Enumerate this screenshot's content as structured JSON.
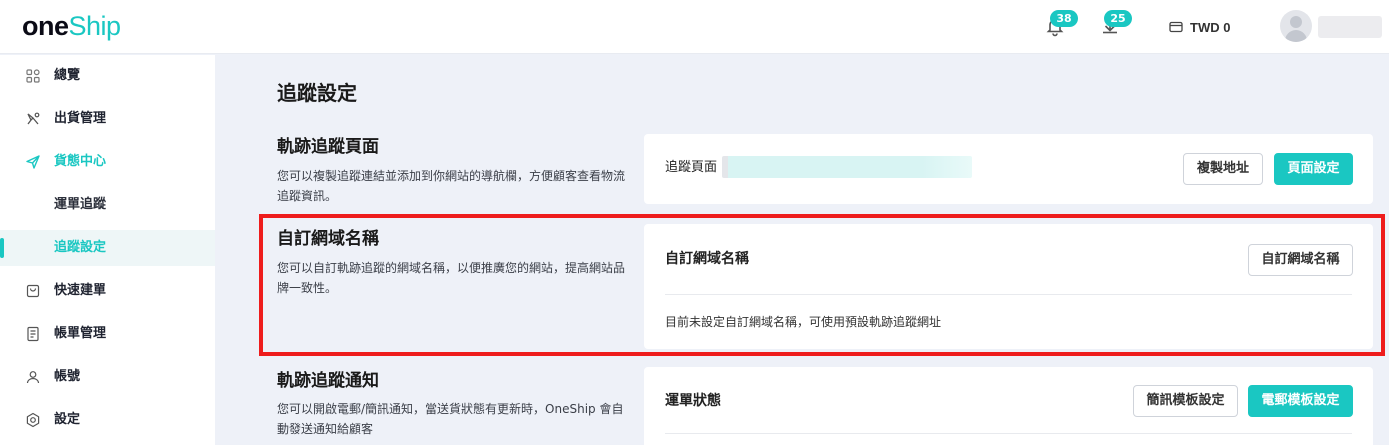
{
  "header": {
    "logo_part1": "one",
    "logo_part2": "Ship",
    "notification_count": "38",
    "download_count": "25",
    "balance": "TWD 0"
  },
  "sidebar": {
    "items": [
      {
        "label": "總覽",
        "icon": "grid-icon"
      },
      {
        "label": "出貨管理",
        "icon": "shipping-icon"
      },
      {
        "label": "貨態中心",
        "icon": "send-icon"
      },
      {
        "label": "運單追蹤",
        "icon": ""
      },
      {
        "label": "追蹤設定",
        "icon": ""
      },
      {
        "label": "快速建單",
        "icon": "bag-icon"
      },
      {
        "label": "帳單管理",
        "icon": "bill-icon"
      },
      {
        "label": "帳號",
        "icon": "user-icon"
      },
      {
        "label": "設定",
        "icon": "gear-icon"
      }
    ]
  },
  "main": {
    "title": "追蹤設定",
    "sections": {
      "tracking_page": {
        "title": "軌跡追蹤頁面",
        "desc": "您可以複製追蹤連結並添加到你網站的導航欄，方便顧客查看物流追蹤資訊。",
        "card_label": "追蹤頁面",
        "copy_button": "複製地址",
        "page_settings_button": "頁面設定"
      },
      "custom_domain": {
        "title": "自訂網域名稱",
        "desc": "您可以自訂軌跡追蹤的網域名稱，以便推廣您的網站，提高網站品牌一致性。",
        "card_label": "自訂網域名稱",
        "button": "自訂網域名稱",
        "note": "目前未設定自訂網域名稱，可使用預設軌跡追蹤網址"
      },
      "tracking_notice": {
        "title": "軌跡追蹤通知",
        "desc": "您可以開啟電郵/簡訊通知，當送貨狀態有更新時，OneShip 會自動發送通知給顧客",
        "card_label": "運單狀態",
        "sms_button": "簡訊模板設定",
        "email_button": "電郵模板設定"
      }
    }
  },
  "colors": {
    "accent": "#1ac7c2",
    "highlight": "#ee1c1c",
    "background": "#eef1f8"
  }
}
